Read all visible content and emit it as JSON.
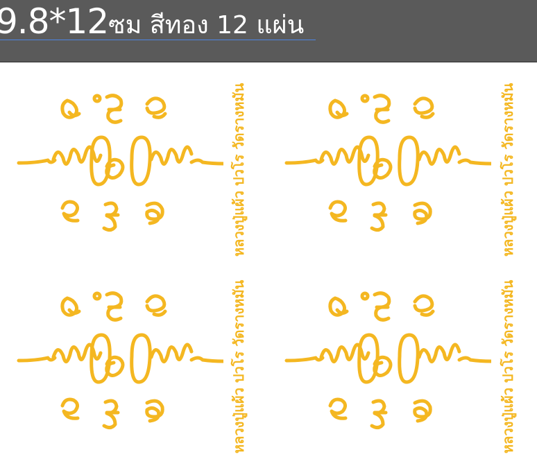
{
  "title": {
    "size_text": "9.8*12",
    "desc_text": "ซม สีทอง 12 แผ่น"
  },
  "colors": {
    "gold": "#f4b721",
    "title_bg": "#5a5a5a",
    "underline": "#4d86e6"
  },
  "tattoo": {
    "top_row": [
      "ห",
      "อุ",
      "ช"
    ],
    "bottom_row": [
      "ช",
      "นะ",
      "อ"
    ],
    "side_text": "หลวงปู่แผ้ว ปวโร วัดรางหมัน"
  }
}
